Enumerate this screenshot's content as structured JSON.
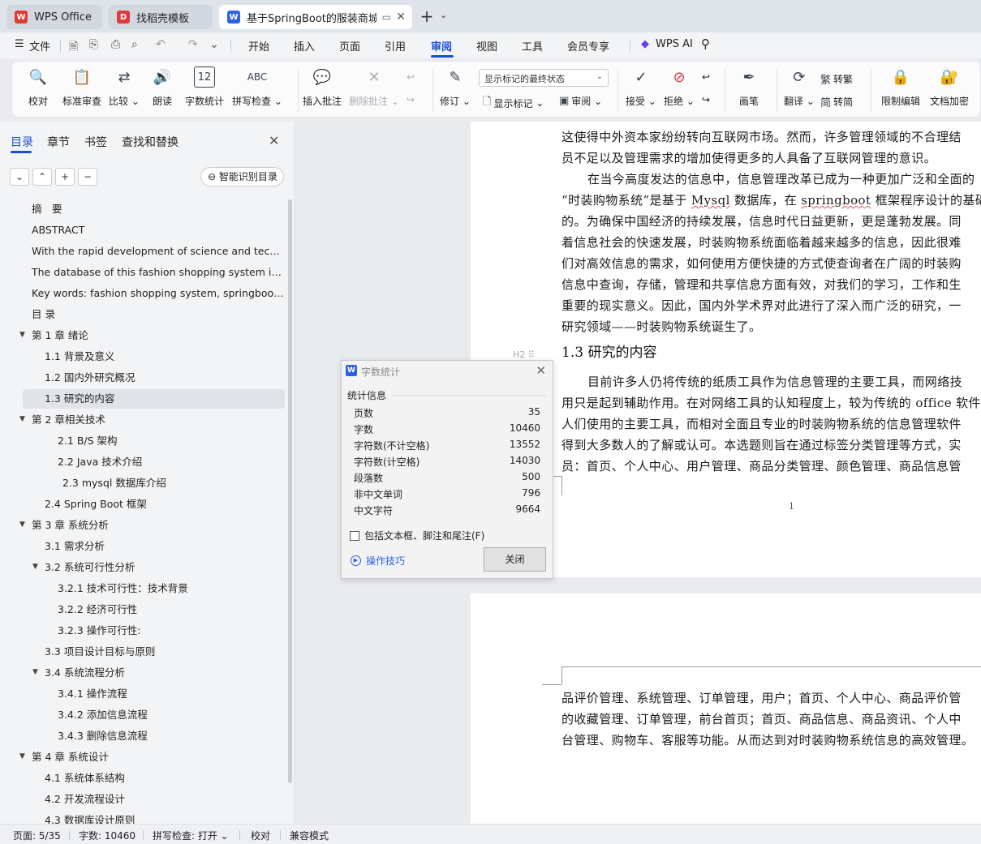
{
  "tabs": [
    {
      "label": "WPS Office",
      "logo": "W",
      "color": "#e03b2f"
    },
    {
      "label": "找稻壳模板",
      "logo": "D",
      "color": "#e0393e"
    },
    {
      "label": "基于SpringBoot的服装商城购",
      "logo": "W",
      "color": "#2c63e6"
    }
  ],
  "menu": {
    "file": "文件",
    "items": [
      "开始",
      "插入",
      "页面",
      "引用",
      "审阅",
      "视图",
      "工具",
      "会员专享"
    ],
    "active": "审阅",
    "ai": "WPS AI"
  },
  "ribbon": {
    "proofread": "校对",
    "standard_review": "标准审查",
    "compare": "比较",
    "read_aloud": "朗读",
    "word_count": "字数统计",
    "spell_check": "拼写检查",
    "insert_comment": "插入批注",
    "delete_comment": "删除批注",
    "revise": "修订",
    "markup_state": "显示标记的最终状态",
    "show_markup": "显示标记",
    "review": "审阅",
    "accept": "接受",
    "reject": "拒绝",
    "ink": "画笔",
    "translate": "翻译",
    "to_traditional": "转繁",
    "to_simplified": "转简",
    "restrict_edit": "限制编辑",
    "doc_encrypt": "文档加密"
  },
  "nav": {
    "tabs": [
      "目录",
      "章节",
      "书签",
      "查找和替换"
    ],
    "active_tab": "目录",
    "smart_toc": "智能识别目录",
    "toc": [
      {
        "label": "摘　要",
        "level": 0,
        "caret": ""
      },
      {
        "label": "ABSTRACT",
        "level": 0,
        "caret": ""
      },
      {
        "label": "With the rapid development of science and techno ...",
        "level": 0,
        "caret": ""
      },
      {
        "label": "The database of this fashion shopping system is m...",
        "level": 0,
        "caret": ""
      },
      {
        "label": "Key words: fashion shopping system, springboot fr ...",
        "level": 0,
        "caret": ""
      },
      {
        "label": "目 录",
        "level": 0,
        "caret": ""
      },
      {
        "label": "第 1 章  绪论",
        "level": 0,
        "caret": "open"
      },
      {
        "label": "1.1 背景及意义",
        "level": 1,
        "caret": ""
      },
      {
        "label": "1.2  国内外研究概况",
        "level": 1,
        "caret": ""
      },
      {
        "label": "1.3  研究的内容",
        "level": 1,
        "caret": "",
        "selected": true
      },
      {
        "label": "第 2 章相关技术",
        "level": 0,
        "caret": "open"
      },
      {
        "label": "2.1    B/S 架构",
        "level": 2,
        "caret": ""
      },
      {
        "label": "2.2    Java 技术介绍",
        "level": 2,
        "caret": ""
      },
      {
        "label": "2.3 mysql 数据库介绍",
        "level": 2.4,
        "caret": ""
      },
      {
        "label": "2.4 Spring    Boot 框架",
        "level": 1,
        "caret": ""
      },
      {
        "label": "第 3 章  系统分析",
        "level": 0,
        "caret": "open"
      },
      {
        "label": "3.1  需求分析",
        "level": 1,
        "caret": ""
      },
      {
        "label": "3.2  系统可行性分析",
        "level": 1,
        "caret": "open"
      },
      {
        "label": "3.2.1 技术可行性：技术背景",
        "level": 2,
        "caret": ""
      },
      {
        "label": "3.2.2 经济可行性",
        "level": 2,
        "caret": ""
      },
      {
        "label": "3.2.3 操作可行性:",
        "level": 2,
        "caret": ""
      },
      {
        "label": "3.3  项目设计目标与原则",
        "level": 1,
        "caret": ""
      },
      {
        "label": "3.4 系统流程分析",
        "level": 1,
        "caret": "open"
      },
      {
        "label": "3.4.1 操作流程",
        "level": 2,
        "caret": ""
      },
      {
        "label": "3.4.2 添加信息流程",
        "level": 2,
        "caret": ""
      },
      {
        "label": "3.4.3 删除信息流程",
        "level": 2,
        "caret": ""
      },
      {
        "label": "第 4 章  系统设计",
        "level": 0,
        "caret": "open"
      },
      {
        "label": "4.1  系统体系结构",
        "level": 1,
        "caret": ""
      },
      {
        "label": "4.2 开发流程设计",
        "level": 1,
        "caret": ""
      },
      {
        "label": "4.3 数据库设计原则",
        "level": 1,
        "caret": ""
      }
    ]
  },
  "document": {
    "page1_lines": [
      "这使得中外资本家纷纷转向互联网市场。然而，许多管理领域的不合理结",
      "员不足以及管理需求的增加使得更多的人具备了互联网管理的意识。",
      "在当今高度发达的信息中，信息管理改革已成为一种更加广泛和全面的",
      "“时装购物系统”是基于 Mysql 数据库，在 springboot 框架程序设计的基础",
      "的。为确保中国经济的持续发展，信息时代日益更新，更是蓬勃发展。同",
      "着信息社会的快速发展，时装购物系统面临着越来越多的信息，因此很难",
      "们对高效信息的需求，如何使用方便快捷的方式使查询者在广阔的时装购",
      "信息中查询，存储，管理和共享信息方面有效，对我们的学习，工作和生",
      "重要的现实意义。因此，国内外学术界对此进行了深入而广泛的研究，一",
      "研究领域——时装购物系统诞生了。"
    ],
    "heading": "1.3  研究的内容",
    "page1_lines_b": [
      "目前许多人仍将传统的纸质工具作为信息管理的主要工具，而网络技",
      "用只是起到辅助作用。在对网络工具的认知程度上，较为传统的 office 软件",
      "人们使用的主要工具，而相对全面且专业的时装购物系统的信息管理软件",
      "得到大多数人的了解或认可。本选题则旨在通过标签分类管理等方式，实",
      "员：首页、个人中心、用户管理、商品分类管理、颜色管理、商品信息管"
    ],
    "page_number": "1",
    "page2_lines": [
      "品评价管理、系统管理、订单管理，用户；首页、个人中心、商品评价管",
      "的收藏管理、订单管理，前台首页；首页、商品信息、商品资讯、个人中",
      "台管理、购物车、客服等功能。从而达到对时装购物系统信息的高效管理。"
    ],
    "heading_ctl": "H2 ⠿"
  },
  "dialog": {
    "title": "字数统计",
    "section": "统计信息",
    "rows": [
      {
        "label": "页数",
        "value": "35"
      },
      {
        "label": "字数",
        "value": "10460"
      },
      {
        "label": "字符数(不计空格)",
        "value": "13552"
      },
      {
        "label": "字符数(计空格)",
        "value": "14030"
      },
      {
        "label": "段落数",
        "value": "500"
      },
      {
        "label": "非中文单词",
        "value": "796"
      },
      {
        "label": "中文字符",
        "value": "9664"
      }
    ],
    "checkbox": "包括文本框、脚注和尾注(F)",
    "tips": "操作技巧",
    "close": "关闭"
  },
  "status": {
    "page": "页面: 5/35",
    "words": "字数: 10460",
    "spell": "拼写检查: 打开",
    "proof": "校对",
    "compat": "兼容模式"
  }
}
